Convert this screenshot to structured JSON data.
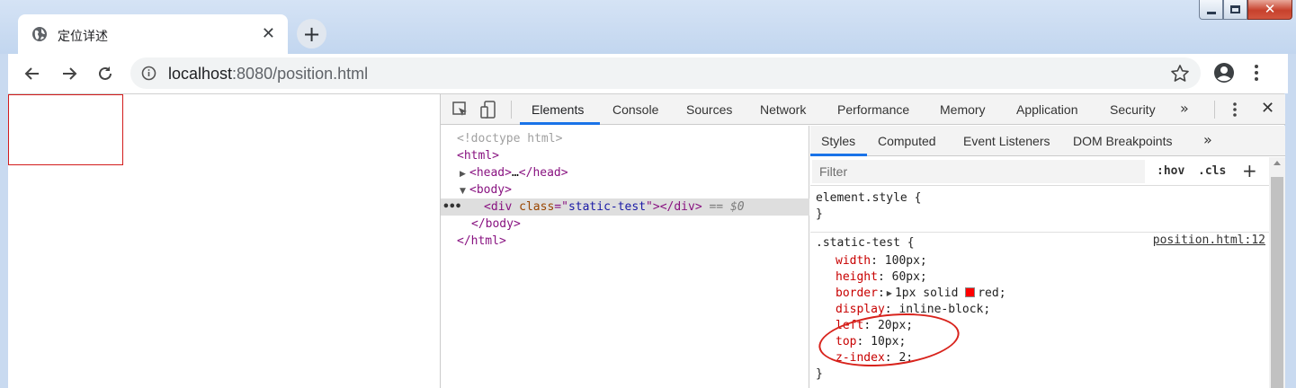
{
  "browser": {
    "tab_title": "定位详述",
    "tab_close": "✕",
    "new_tab": "+",
    "url_host": "localhost",
    "url_rest": ":8080/position.html"
  },
  "window_controls": {
    "close": "✕"
  },
  "devtools": {
    "tabs": [
      "Elements",
      "Console",
      "Sources",
      "Network",
      "Performance",
      "Memory",
      "Application",
      "Security"
    ],
    "more": "»",
    "close": "✕",
    "dom": {
      "doctype": "<!doctype html>",
      "html_open": "<html>",
      "head_open": "<head>",
      "head_ellipsis": "…",
      "head_close": "</head>",
      "body_open": "<body>",
      "div_open_tag": "<div",
      "div_attr": "class",
      "div_eq": "=\"",
      "div_val": "static-test",
      "div_quote": "\">",
      "div_close": "</div>",
      "selected_marker": "== $0",
      "gutter": "•••",
      "body_close": "</body>",
      "html_close": "</html>"
    },
    "styles": {
      "tabs": [
        "Styles",
        "Computed",
        "Event Listeners",
        "DOM Breakpoints"
      ],
      "more": "»",
      "filter_placeholder": "Filter",
      "hov": ":hov",
      "cls": ".cls",
      "add": "+",
      "element_style_open": "element.style {",
      "brace_close": "}",
      "selector": ".static-test {",
      "source": "position.html:12",
      "declarations": [
        {
          "prop": "width",
          "value": " 100px;"
        },
        {
          "prop": "height",
          "value": " 60px;"
        },
        {
          "prop": "border",
          "value": "1px solid ",
          "extra": "red;"
        },
        {
          "prop": "display",
          "value": " inline-block;"
        },
        {
          "prop": "left",
          "value": " 20px;"
        },
        {
          "prop": "top",
          "value": " 10px;"
        },
        {
          "prop": "z-index",
          "value": " 2;"
        }
      ],
      "colon": ":"
    }
  },
  "colors": {
    "red_swatch": "#ff0000",
    "accent": "#1a73e8",
    "annotation": "#d8231c"
  }
}
